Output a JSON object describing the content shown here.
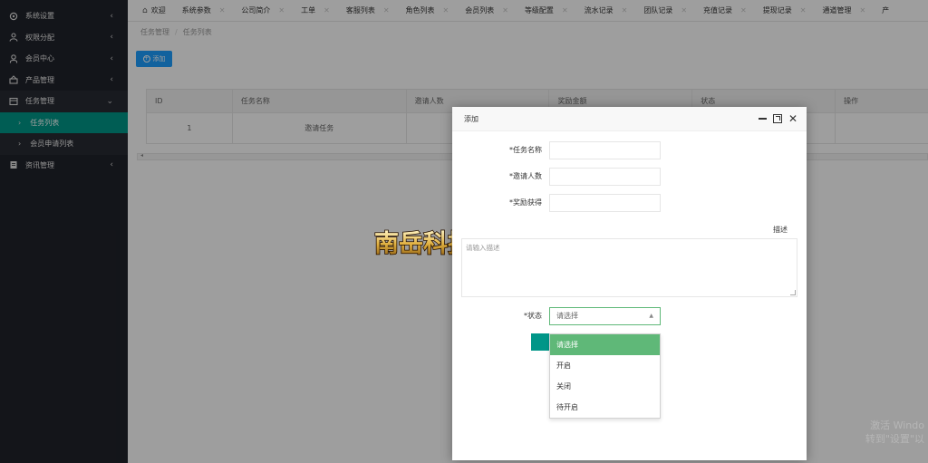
{
  "sidebar": {
    "items": [
      {
        "label": "系统设置",
        "icon": "settings-icon",
        "arrow": "‹"
      },
      {
        "label": "权限分配",
        "icon": "users-icon",
        "arrow": "‹"
      },
      {
        "label": "会员中心",
        "icon": "user-icon",
        "arrow": "‹"
      },
      {
        "label": "产品管理",
        "icon": "product-icon",
        "arrow": "‹"
      },
      {
        "label": "任务管理",
        "icon": "task-icon",
        "arrow": "⌄"
      },
      {
        "label": "任务列表",
        "sub": true,
        "active": true
      },
      {
        "label": "会员申请列表",
        "sub": true
      },
      {
        "label": "资讯管理",
        "icon": "news-icon",
        "arrow": "‹"
      }
    ]
  },
  "tabs": [
    {
      "label": "欢迎",
      "home": true
    },
    {
      "label": "系统参数"
    },
    {
      "label": "公司简介"
    },
    {
      "label": "工单"
    },
    {
      "label": "客服列表"
    },
    {
      "label": "角色列表"
    },
    {
      "label": "会员列表"
    },
    {
      "label": "等级配置"
    },
    {
      "label": "流水记录"
    },
    {
      "label": "团队记录"
    },
    {
      "label": "充值记录"
    },
    {
      "label": "提现记录"
    },
    {
      "label": "通道管理"
    },
    {
      "label": "产"
    }
  ],
  "breadcrumb": {
    "parent": "任务管理",
    "sep": "/",
    "current": "任务列表"
  },
  "toolbar": {
    "add_label": "添加"
  },
  "table": {
    "headers": [
      "ID",
      "任务名称",
      "邀请人数",
      "奖励金额",
      "状态",
      "操作"
    ],
    "rows": [
      [
        "1",
        "邀请任务",
        "",
        "",
        "",
        ""
      ]
    ]
  },
  "modal": {
    "title": "添加",
    "fields": {
      "task_name_label": "*任务名称",
      "invite_count_label": "*邀请人数",
      "reward_label": "*奖励获得",
      "description_label": "描述",
      "description_placeholder": "请输入描述",
      "status_label": "*状态",
      "status_value": "请选择"
    },
    "status_options": [
      "请选择",
      "开启",
      "关闭",
      "待开启"
    ]
  },
  "watermark": {
    "text": "南岳科技"
  },
  "os_watermark": {
    "line1": "激活 Windo",
    "line2": "转到\"设置\"以"
  },
  "colors": {
    "sidebar": "#20222a",
    "accent": "#009688",
    "primary": "#1e9fff",
    "select_green": "#5fb878"
  }
}
